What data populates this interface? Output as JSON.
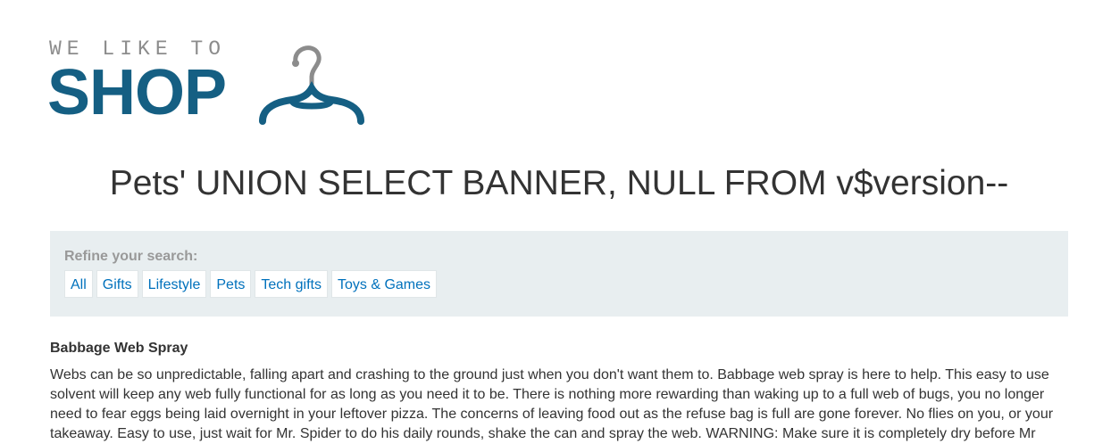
{
  "logo": {
    "top_text": "WE LIKE TO",
    "main_text": "SHOP",
    "brand_color": "#155f83",
    "icon": "hanger-icon"
  },
  "title": "Pets' UNION SELECT BANNER, NULL FROM v$version--",
  "filter": {
    "label": "Refine your search:",
    "categories": [
      "All",
      "Gifts",
      "Lifestyle",
      "Pets",
      "Tech gifts",
      "Toys & Games"
    ],
    "link_color": "#0071bc",
    "background_color": "#e8eef0"
  },
  "products": [
    {
      "name": "Babbage Web Spray",
      "description": "Webs can be so unpredictable, falling apart and crashing to the ground just when you don't want them to. Babbage web spray is here to help. This easy to use solvent will keep any web fully functional for as long as you need it to be. There is nothing more rewarding than waking up to a full web of bugs, you no longer need to fear eggs being laid overnight in your leftover pizza. The concerns of leaving food out as the refuse bag is full are gone forever. No flies on you, or your takeaway. Easy to use, just wait for Mr. Spider to do his daily rounds, shake the can and spray the web. WARNING: Make sure it is completely dry before Mr"
    }
  ]
}
